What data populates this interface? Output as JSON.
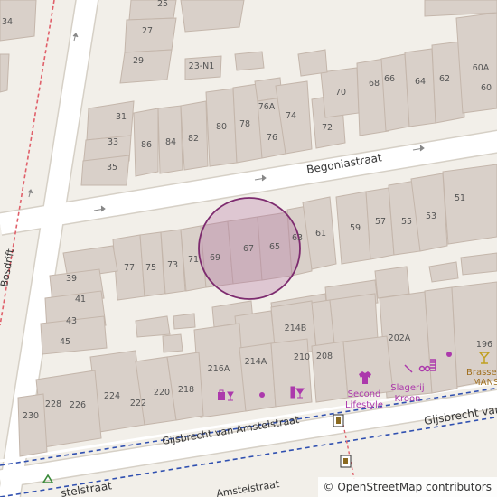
{
  "map": {
    "streets": [
      {
        "id": "begoniastraat",
        "label": "Begoniastraat"
      },
      {
        "id": "bosdrift",
        "label": "Bosdrift"
      },
      {
        "id": "gijsbrecht-upper",
        "label": "Gijsbrecht van Amstelstraat"
      },
      {
        "id": "gijsbrecht-right",
        "label": "Gijsbrecht van"
      },
      {
        "id": "gijsbrecht-lower-left",
        "label": "stelstraat"
      },
      {
        "id": "gijsbrecht-lower-mid",
        "label": "Amstelstraat"
      }
    ],
    "house_numbers": [
      "34",
      "25",
      "27",
      "29",
      "23-N1",
      "31",
      "33",
      "35",
      "86",
      "84",
      "82",
      "80",
      "78",
      "76A",
      "74",
      "76",
      "72",
      "70",
      "68",
      "66",
      "64",
      "62",
      "60A",
      "60",
      "51",
      "53",
      "55",
      "57",
      "59",
      "61",
      "63",
      "65",
      "67",
      "69",
      "71",
      "73",
      "75",
      "77",
      "39",
      "41",
      "43",
      "45",
      "214B",
      "210",
      "208",
      "214A",
      "216A",
      "202A",
      "196",
      "224",
      "222",
      "220",
      "218",
      "228",
      "226",
      "230"
    ],
    "pois": [
      {
        "id": "second-lifestyle",
        "label_lines": [
          "Second",
          "Lifestyle"
        ],
        "icon": "clothes-shop-icon"
      },
      {
        "id": "slagerij-kroon",
        "label_lines": [
          "Slagerij",
          "Kroon"
        ],
        "icon": "butcher-icon"
      },
      {
        "id": "brasserie-mans",
        "label_lines": [
          "Brasser",
          "MANS"
        ],
        "icon": "cocktail-bar-icon"
      }
    ],
    "other_icons": [
      "gift-shop-icon",
      "cafe-icon",
      "shop-dot-icon",
      "recycling-icon",
      "bus-stop-icon"
    ],
    "highlight": {
      "label": "location-circle"
    },
    "colors": {
      "background": "#f2efe9",
      "building": "#d9d0c9",
      "building_stroke": "#c4b6ab",
      "road": "#ffffff",
      "road_casing": "#d6d0c6",
      "highlight_fill": "#b06aa0",
      "poi": "#ac39ac",
      "rail_red": "#e0606a",
      "bus_blue": "#3050b0"
    }
  },
  "attribution": "© OpenStreetMap contributors"
}
